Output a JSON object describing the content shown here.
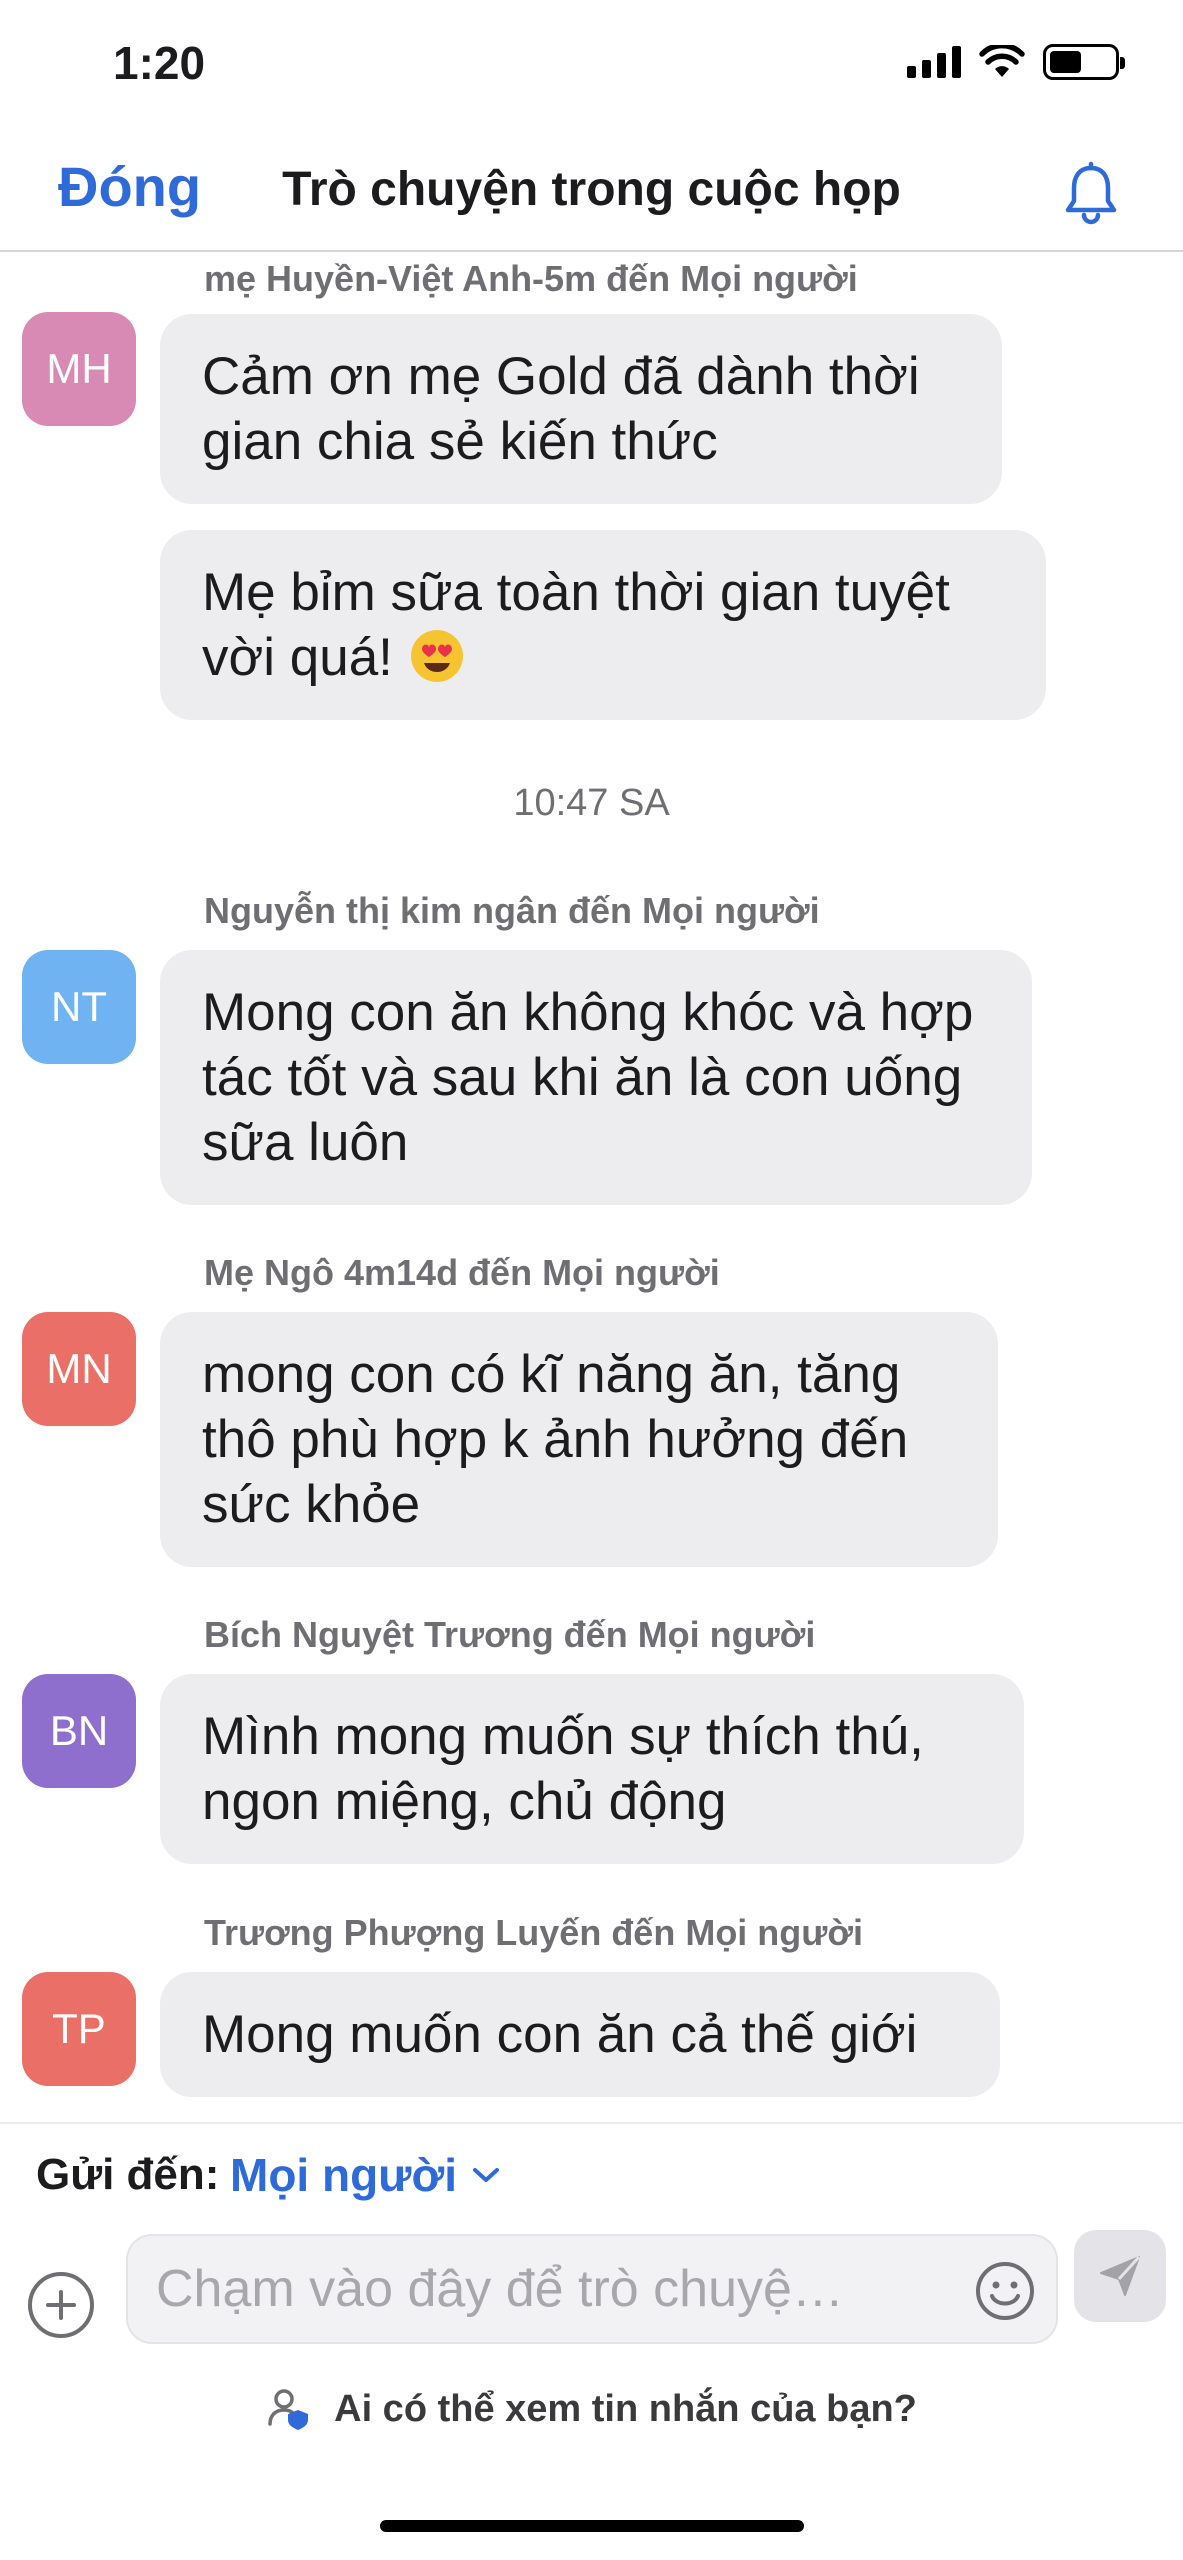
{
  "status_bar": {
    "time": "1:20"
  },
  "header": {
    "close_label": "Đóng",
    "title": "Trò chuyện trong cuộc họp"
  },
  "chat": {
    "time_divider": "10:47 SA",
    "groups": [
      {
        "sender": "mẹ Huyền-Việt Anh-5m đến Mọi người",
        "initials": "MH",
        "avatar_color": "#d889b4",
        "messages": [
          "Cảm ơn mẹ Gold đã dành thời gian chia sẻ kiến thức",
          "Mẹ bỉm sữa toàn thời gian tuyệt vời quá!"
        ]
      },
      {
        "sender": "Nguyễn thị kim ngân đến Mọi người",
        "initials": "NT",
        "avatar_color": "#6fb3f2",
        "messages": [
          "Mong con ăn không khóc và hợp tác tốt và sau khi ăn là con uống sữa luôn"
        ]
      },
      {
        "sender": "Mẹ Ngô 4m14d đến Mọi người",
        "initials": "MN",
        "avatar_color": "#ea6f66",
        "messages": [
          "mong con có kĩ năng ăn, tăng thô phù hợp k ảnh hưởng đến sức khỏe"
        ]
      },
      {
        "sender": "Bích Nguyệt Trương đến Mọi người",
        "initials": "BN",
        "avatar_color": "#8e6fcd",
        "messages": [
          "Mình mong muốn sự thích thú, ngon miệng, chủ động"
        ]
      },
      {
        "sender": "Trương Phượng Luyến đến Mọi người",
        "initials": "TP",
        "avatar_color": "#ea6f66",
        "messages": [
          "Mong muốn con ăn cả thế giới"
        ]
      }
    ]
  },
  "composer": {
    "send_to_label": "Gửi đến:",
    "send_to_value": "Mọi người",
    "placeholder": "Chạm vào đây để trò chuyệ…",
    "privacy_text": "Ai có thể xem tin nhắn của bạn?"
  },
  "colors": {
    "accent": "#2f6ad9",
    "bubble": "#ededf0",
    "muted_text": "#6e6e73"
  },
  "icons": [
    "signal-icon",
    "wifi-icon",
    "battery-icon",
    "bell-icon",
    "heart-eyes-emoji",
    "chevron-down-icon",
    "plus-icon",
    "smiley-icon",
    "send-icon",
    "privacy-icon"
  ]
}
